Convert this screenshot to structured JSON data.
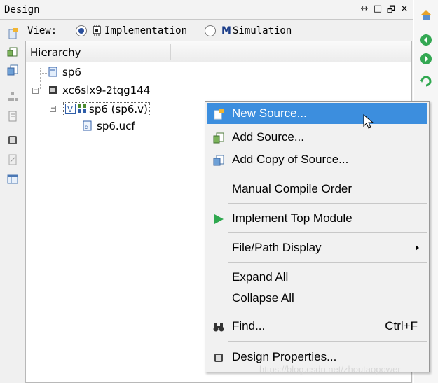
{
  "panel": {
    "title": "Design",
    "controls": [
      "↔",
      "□",
      "🗗",
      "×"
    ]
  },
  "view": {
    "label": "View:",
    "implementation": "Implementation",
    "simulation": "Simulation",
    "selected": "implementation"
  },
  "tree": {
    "header": "Hierarchy",
    "nodes": [
      {
        "label": "sp6",
        "icon": "project-icon"
      },
      {
        "label": "xc6slx9-2tqg144",
        "icon": "chip-icon"
      },
      {
        "label": "sp6 (sp6.v)",
        "icon": "verilog-module-icon"
      },
      {
        "label": "sp6.ucf",
        "icon": "constraints-file-icon"
      }
    ]
  },
  "menu": {
    "new_source": "New Source...",
    "add_source": "Add Source...",
    "add_copy_source": "Add Copy of Source...",
    "manual_compile": "Manual Compile Order",
    "implement_top": "Implement Top Module",
    "file_path_display": "File/Path Display",
    "expand_all": "Expand All",
    "collapse_all": "Collapse All",
    "find": "Find...",
    "find_shortcut": "Ctrl+F",
    "design_properties": "Design Properties..."
  },
  "colors": {
    "highlight": "#3c8ede",
    "play": "#2fa84f",
    "nav_green": "#34a853"
  },
  "watermark": "https://blog.csdn.net/zhoutaopower"
}
